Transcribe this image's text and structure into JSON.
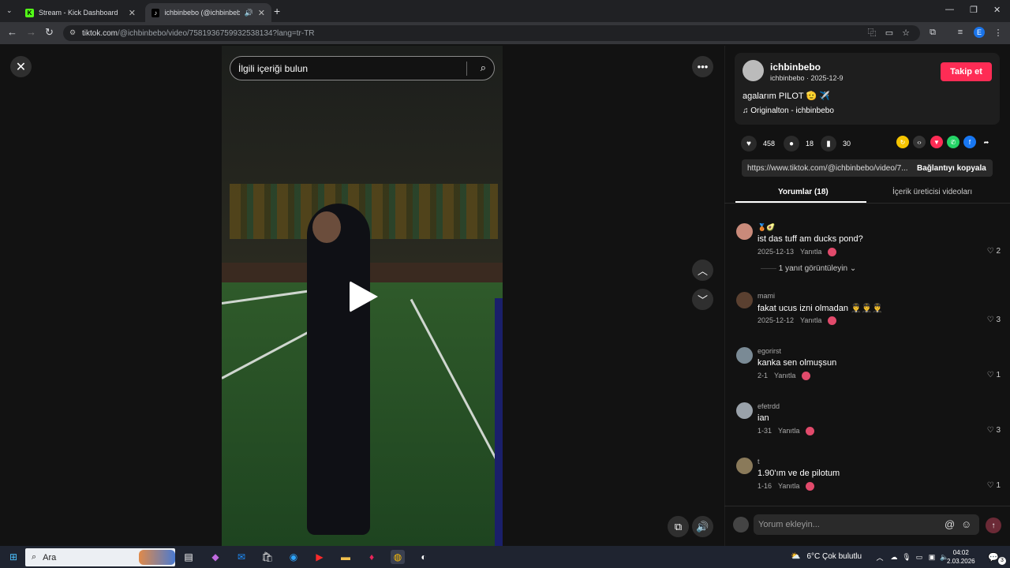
{
  "browser": {
    "tabs": [
      {
        "title": "Stream - Kick Dashboard",
        "favicon": "kick-icon",
        "favicon_color": "#53fc18"
      },
      {
        "title": "ichbinbebo (@ichbinbebo)",
        "favicon": "tiktok-icon",
        "favicon_color": "#000000"
      }
    ],
    "url_host": "tiktok.com",
    "url_path": "/@ichbinbebo/video/7581936759932538134?lang=tr-TR",
    "profile_letter": "E"
  },
  "search": {
    "placeholder": "İlgili içeriği bulun"
  },
  "author": {
    "username": "ichbinbebo",
    "subline": "ichbinbebo · 2025-12-9",
    "follow_label": "Takip et",
    "caption": "agalarım PILOT 🫡 ✈️",
    "music": "Originalton - ichbinbebo"
  },
  "stats": {
    "likes": "458",
    "comments": "18",
    "saves": "30"
  },
  "share": {
    "link": "https://www.tiktok.com/@ichbinbebo/video/7...",
    "copy_label": "Bağlantıyı kopyala"
  },
  "tabs": {
    "comments": "Yorumlar (18)",
    "creator_videos": "İçerik üreticisi videoları"
  },
  "comments": [
    {
      "user": "🥉🥑",
      "text": "ist das tuff am ducks pond?",
      "date": "2025-12-13",
      "reply": "Yanıtla",
      "likes": "2",
      "avatar_color": "#c98a7a"
    },
    {
      "user": "mami",
      "text": "fakat ucus izni olmadan 👨‍✈️👨‍✈️👨‍✈️",
      "date": "2025-12-12",
      "reply": "Yanıtla",
      "likes": "3",
      "avatar_color": "#5a4030"
    },
    {
      "user": "egorirst",
      "text": "kanka sen olmuşsun",
      "date": "2-1",
      "reply": "Yanıtla",
      "likes": "1",
      "avatar_color": "#7a8a95"
    },
    {
      "user": "efetrdd",
      "text": "ian",
      "date": "1-31",
      "reply": "Yanıtla",
      "likes": "3",
      "avatar_color": "#9aa2aa"
    },
    {
      "user": "t",
      "text": "1.90'ım ve de pilotum",
      "date": "1-16",
      "reply": "Yanıtla",
      "likes": "1",
      "avatar_color": "#8a7a5a"
    }
  ],
  "view_replies": "1 yanıt görüntüleyin",
  "comment_input": {
    "placeholder": "Yorum ekleyin..."
  },
  "taskbar": {
    "search": "Ara",
    "weather": "6°C  Çok bulutlu",
    "time": "04:02",
    "date": "2.03.2026",
    "notif_count": "3"
  }
}
